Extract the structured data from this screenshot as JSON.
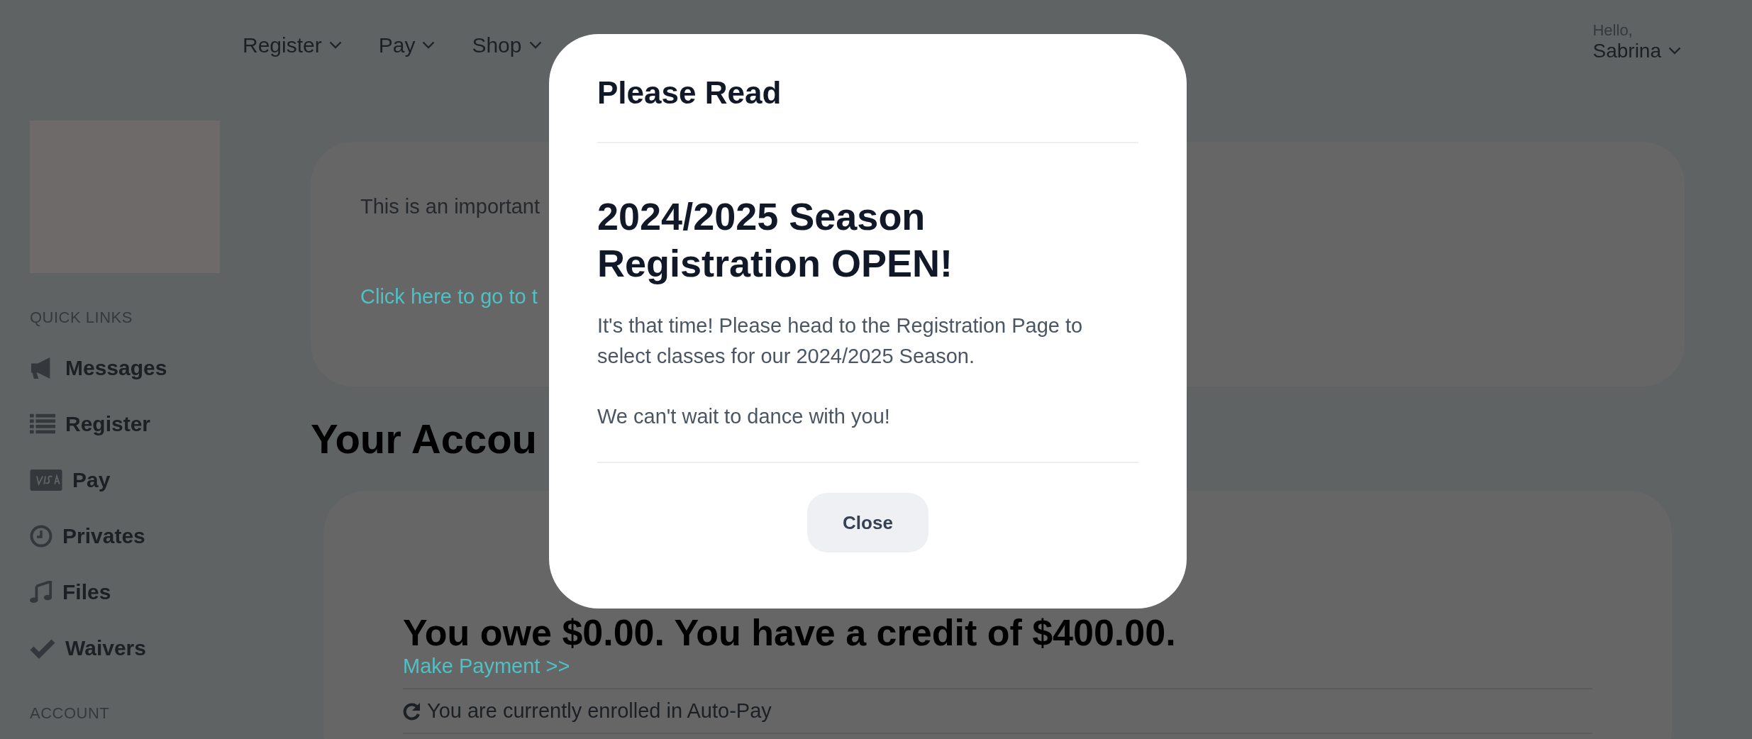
{
  "nav": {
    "items": [
      {
        "label": "Register"
      },
      {
        "label": "Pay"
      },
      {
        "label": "Shop"
      }
    ],
    "greeting": "Hello,",
    "user": "Sabrina"
  },
  "sidebar": {
    "heading": "QUICK LINKS",
    "items": [
      {
        "label": "Messages"
      },
      {
        "label": "Register"
      },
      {
        "label": "Pay"
      },
      {
        "label": "Privates"
      },
      {
        "label": "Files"
      },
      {
        "label": "Waivers"
      }
    ],
    "section_2": "ACCOUNT"
  },
  "notice": {
    "text": "This is an important",
    "link": "Click here to go to t"
  },
  "account": {
    "heading": "Your Accou",
    "balance": "You owe $0.00. You have a credit of $400.00.",
    "payment_link": "Make Payment >>",
    "autopay": "You are currently enrolled in Auto-Pay"
  },
  "modal": {
    "title": "Please Read",
    "headline": "2024/2025 Season Registration OPEN!",
    "paragraphs": [
      "It's that time! Please head to the Registration Page to select classes for our 2024/2025 Season.",
      "We can't wait to dance with you!"
    ],
    "button": "Close"
  }
}
